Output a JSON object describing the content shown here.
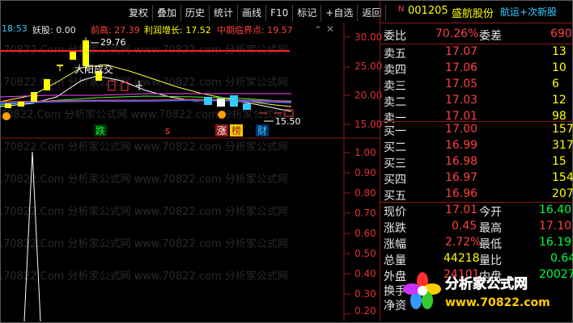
{
  "toolbar": [
    "复权",
    "叠加",
    "历史",
    "统计",
    "画线",
    "F10",
    "标记",
    "+自选",
    "返回"
  ],
  "chart": {
    "time": "18:53",
    "indicator_name": "妖股: 0.00",
    "prev_high_label": "前高: 27.39",
    "profit_label": "利润增长: 17.52",
    "mid_label": "中期临界点: 19.57",
    "scale_top": [
      "30.00",
      "25.00",
      "20.00",
      "15.00"
    ],
    "scale_bottom": [
      "1.00",
      "0.90",
      "0.80",
      "0.70",
      "0.60",
      "0.50",
      "0.40",
      "0.30",
      "0.20",
      "0.10"
    ],
    "peak_label": "29.76",
    "low_label": "15.50",
    "cross_label": "大阳成交",
    "tag_fall": "跌",
    "tag_s": "s",
    "tag_up": "涨",
    "tag_rank": "榜",
    "tag_fin": "财",
    "watermark": "www.70822.com 分析家公式网"
  },
  "quote": {
    "n_mark": "N",
    "code": "001205",
    "name": "盛航股份",
    "sector": "航运+次新股",
    "ratio_label": "委比",
    "ratio_value": "70.26%",
    "diff_label": "委差",
    "diff_value": "690",
    "asks": [
      {
        "label": "卖五",
        "price": "17.07",
        "vol": "13"
      },
      {
        "label": "卖四",
        "price": "17.06",
        "vol": "10"
      },
      {
        "label": "卖三",
        "price": "17.05",
        "vol": "6"
      },
      {
        "label": "卖二",
        "price": "17.03",
        "vol": "12"
      },
      {
        "label": "卖一",
        "price": "17.01",
        "vol": "98"
      }
    ],
    "bids": [
      {
        "label": "买一",
        "price": "17.00",
        "vol": "157"
      },
      {
        "label": "买二",
        "price": "16.99",
        "vol": "317"
      },
      {
        "label": "买三",
        "price": "16.98",
        "vol": "15"
      },
      {
        "label": "买四",
        "price": "16.97",
        "vol": "154"
      },
      {
        "label": "买五",
        "price": "16.96",
        "vol": "207"
      }
    ],
    "stats": [
      {
        "l1": "现价",
        "v1": "17.01",
        "l2": "今开",
        "v2": "16.40"
      },
      {
        "l1": "涨跌",
        "v1": "0.45",
        "l2": "最高",
        "v2": "17.10"
      },
      {
        "l1": "涨幅",
        "v1": "2.72%",
        "l2": "最低",
        "v2": "16.19"
      },
      {
        "l1": "总量",
        "v1": "44218",
        "l2": "量比",
        "v2": "0.64"
      },
      {
        "l1": "外盘",
        "v1": "24101",
        "l2": "内盘",
        "v2": "20027"
      },
      {
        "l1": "换手",
        "v1": "",
        "l2": "",
        "v2": ""
      },
      {
        "l1": "净资",
        "v1": "",
        "l2": "",
        "v2": ""
      }
    ]
  },
  "logo": {
    "text": "分析家公式网",
    "url": "www.70822.com"
  },
  "colors": {
    "red": "#ff4040",
    "green": "#00ff40",
    "yellow": "#ffff00",
    "accent": "#8b1a1a"
  }
}
